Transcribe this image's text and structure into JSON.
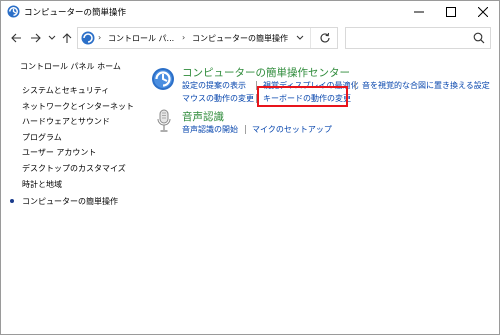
{
  "window": {
    "title": "コンピューターの簡単操作"
  },
  "address_bar": {
    "segments": [
      "コントロール パ...",
      "コンピューターの簡単操作"
    ],
    "search_placeholder": ""
  },
  "left_nav": {
    "home": "コントロール パネル ホーム",
    "items": [
      "システムとセキュリティ",
      "ネットワークとインターネット",
      "ハードウェアとサウンド",
      "プログラム",
      "ユーザー アカウント",
      "デスクトップのカスタマイズ",
      "時計と地域",
      "コンピューターの簡単操作"
    ],
    "current_index": 7
  },
  "categories": [
    {
      "title": "コンピューターの簡単操作センター",
      "tasks": [
        "設定の提案の表示",
        "視覚ディスプレイの最適化",
        "音を視覚的な合図に置き換える設定",
        "マウスの動作の変更",
        "キーボードの動作の変更"
      ]
    },
    {
      "title": "音声認識",
      "tasks": [
        "音声認識の開始",
        "マイクのセットアップ"
      ]
    }
  ],
  "highlighted_task": "キーボードの動作の変更",
  "colors": {
    "category_title": "#2e8b3a",
    "link": "#0645ad",
    "highlight_box": "#e8141b"
  }
}
